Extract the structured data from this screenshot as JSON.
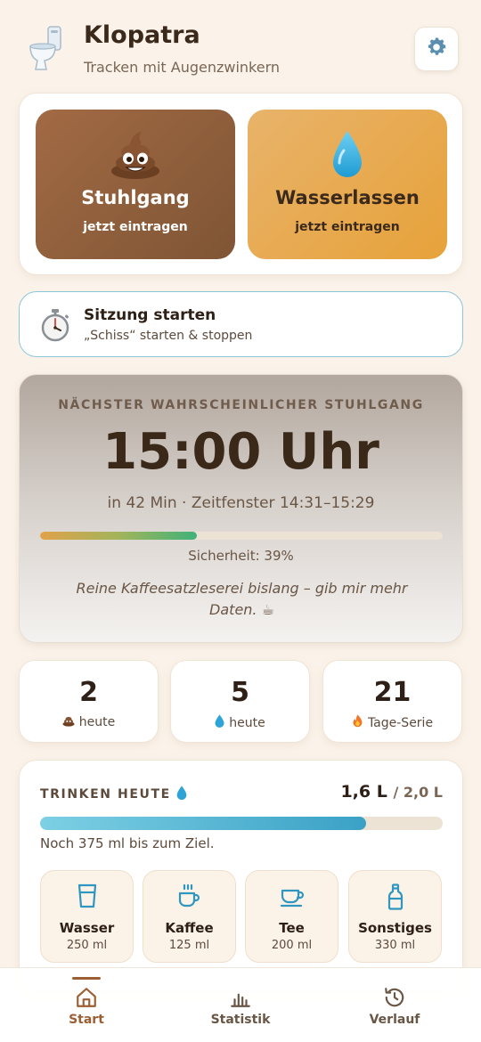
{
  "header": {
    "title": "Klopatra",
    "subtitle": "Tracken mit Augenzwinkern",
    "logo_icon": "toilet-icon",
    "settings_icon": "gear-icon"
  },
  "quick_entry": {
    "poo": {
      "label": "Stuhlgang",
      "sub": "jetzt eintragen",
      "icon": "poo-emoji-icon"
    },
    "water": {
      "label": "Wasserlassen",
      "sub": "jetzt eintragen",
      "icon": "droplet-icon"
    }
  },
  "session": {
    "title": "Sitzung starten",
    "subtitle": "„Schiss“ starten & stoppen",
    "icon": "stopwatch-icon"
  },
  "prediction": {
    "label": "NÄCHSTER WAHRSCHEINLICHER STUHLGANG",
    "time": "15:00 Uhr",
    "window": "in 42 Min · Zeitfenster 14:31–15:29",
    "confidence_label": "Sicherheit: 39%",
    "confidence_fraction": 0.39,
    "note": "Reine Kaffeesatzleserei bislang – gib mir mehr Daten. ☕"
  },
  "stats": [
    {
      "value": "2",
      "label": "heute",
      "icon": "poo-emoji-icon"
    },
    {
      "value": "5",
      "label": "heute",
      "icon": "droplet-icon"
    },
    {
      "value": "21",
      "label": "Tage-Serie",
      "icon": "fire-icon"
    }
  ],
  "drink": {
    "title": "TRINKEN HEUTE",
    "amount": "1,6 L",
    "goal": "/ 2,0 L",
    "progress_fraction": 0.81,
    "remaining": "Noch 375 ml bis zum Ziel.",
    "buttons": [
      {
        "name": "Wasser",
        "ml": "250 ml",
        "icon": "glass-icon"
      },
      {
        "name": "Kaffee",
        "ml": "125 ml",
        "icon": "coffee-cup-icon"
      },
      {
        "name": "Tee",
        "ml": "200 ml",
        "icon": "tea-cup-icon"
      },
      {
        "name": "Sonstiges",
        "ml": "330 ml",
        "icon": "bottle-icon"
      }
    ]
  },
  "nav": [
    {
      "label": "Start",
      "icon": "home-icon",
      "active": true
    },
    {
      "label": "Statistik",
      "icon": "bar-chart-icon",
      "active": false
    },
    {
      "label": "Verlauf",
      "icon": "history-icon",
      "active": false
    }
  ],
  "colors": {
    "background": "#fbf3ea",
    "poo_brown": "#8f5f3d",
    "water_amber": "#e7a94f",
    "session_border": "#8cc6d6",
    "drink_blue": "#3aa1c6",
    "nav_active": "#9b5f33"
  }
}
